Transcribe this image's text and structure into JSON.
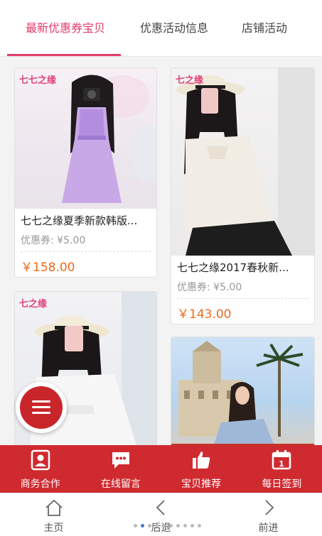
{
  "tabs": [
    {
      "label": "最新优惠券宝贝",
      "active": true
    },
    {
      "label": "优惠活动信息",
      "active": false
    },
    {
      "label": "店铺活动",
      "active": false
    }
  ],
  "products": [
    {
      "name": "七七之缘夏季新款韩版...",
      "coupon": "优惠券: ¥5.00",
      "price": "￥158.00",
      "logo": "七七之缘"
    },
    {
      "name": "七七之缘2017春秋新...",
      "coupon": "优惠券: ¥5.00",
      "price": "￥143.00",
      "logo": "七之缘"
    },
    {
      "logo": "七之缘"
    },
    {}
  ],
  "bottom_menu": [
    {
      "label": "商务合作",
      "icon": "contact-card-icon"
    },
    {
      "label": "在线留言",
      "icon": "chat-bubble-icon"
    },
    {
      "label": "宝贝推荐",
      "icon": "thumbs-up-icon"
    },
    {
      "label": "每日签到",
      "icon": "calendar-icon"
    }
  ],
  "calendar_day": "1",
  "system_nav": [
    {
      "label": "主页",
      "icon": "home-icon"
    },
    {
      "label": "后退",
      "icon": "back-icon"
    },
    {
      "label": "前进",
      "icon": "forward-icon"
    }
  ],
  "colors": {
    "accent": "#e23d6a",
    "price": "#ee6a1a",
    "menu_bar": "#cf2a2f"
  }
}
